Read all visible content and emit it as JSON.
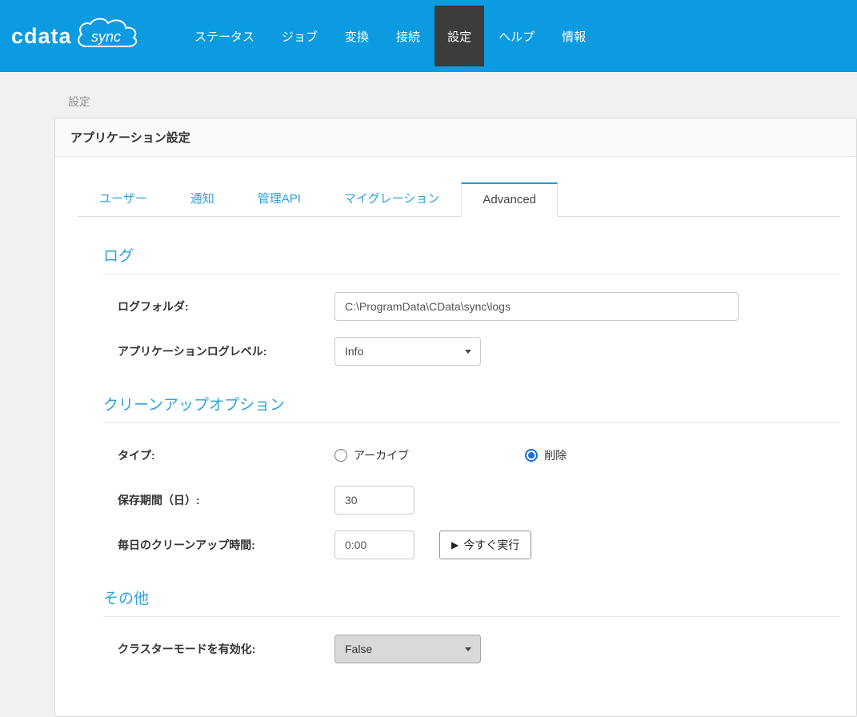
{
  "brand": {
    "name_left": "cdata",
    "name_right": "sync"
  },
  "nav": {
    "items": [
      {
        "label": "ステータス"
      },
      {
        "label": "ジョブ"
      },
      {
        "label": "変換"
      },
      {
        "label": "接続"
      },
      {
        "label": "設定"
      },
      {
        "label": "ヘルプ"
      },
      {
        "label": "情報"
      }
    ],
    "active": "設定"
  },
  "breadcrumb": "設定",
  "card": {
    "title": "アプリケーション設定"
  },
  "tabs": {
    "items": [
      {
        "label": "ユーザー"
      },
      {
        "label": "通知"
      },
      {
        "label": "管理API"
      },
      {
        "label": "マイグレーション"
      },
      {
        "label": "Advanced"
      }
    ],
    "active": "Advanced"
  },
  "log": {
    "title": "ログ",
    "folder_label": "ログフォルダ:",
    "folder_value": "C:\\ProgramData\\CData\\sync\\logs",
    "level_label": "アプリケーションログレベル:",
    "level_value": "Info"
  },
  "cleanup": {
    "title": "クリーンアップオプション",
    "type_label": "タイプ:",
    "archive_label": "アーカイブ",
    "delete_label": "削除",
    "selected_type": "削除",
    "retention_label": "保存期間（日）:",
    "retention_value": "30",
    "time_label": "毎日のクリーンアップ時間:",
    "time_value": "0:00",
    "run_icon": "▶",
    "run_label": "今すぐ実行"
  },
  "other": {
    "title": "その他",
    "cluster_label": "クラスターモードを有効化:",
    "cluster_value": "False",
    "cluster_disabled": true
  },
  "colors": {
    "navbar": "#0c9be0",
    "nav_active_bg": "#3c3c3c",
    "accent": "#2fa4d9",
    "tab_active_top": "#1e9cd8",
    "radio_checked": "#1d6fd1"
  }
}
